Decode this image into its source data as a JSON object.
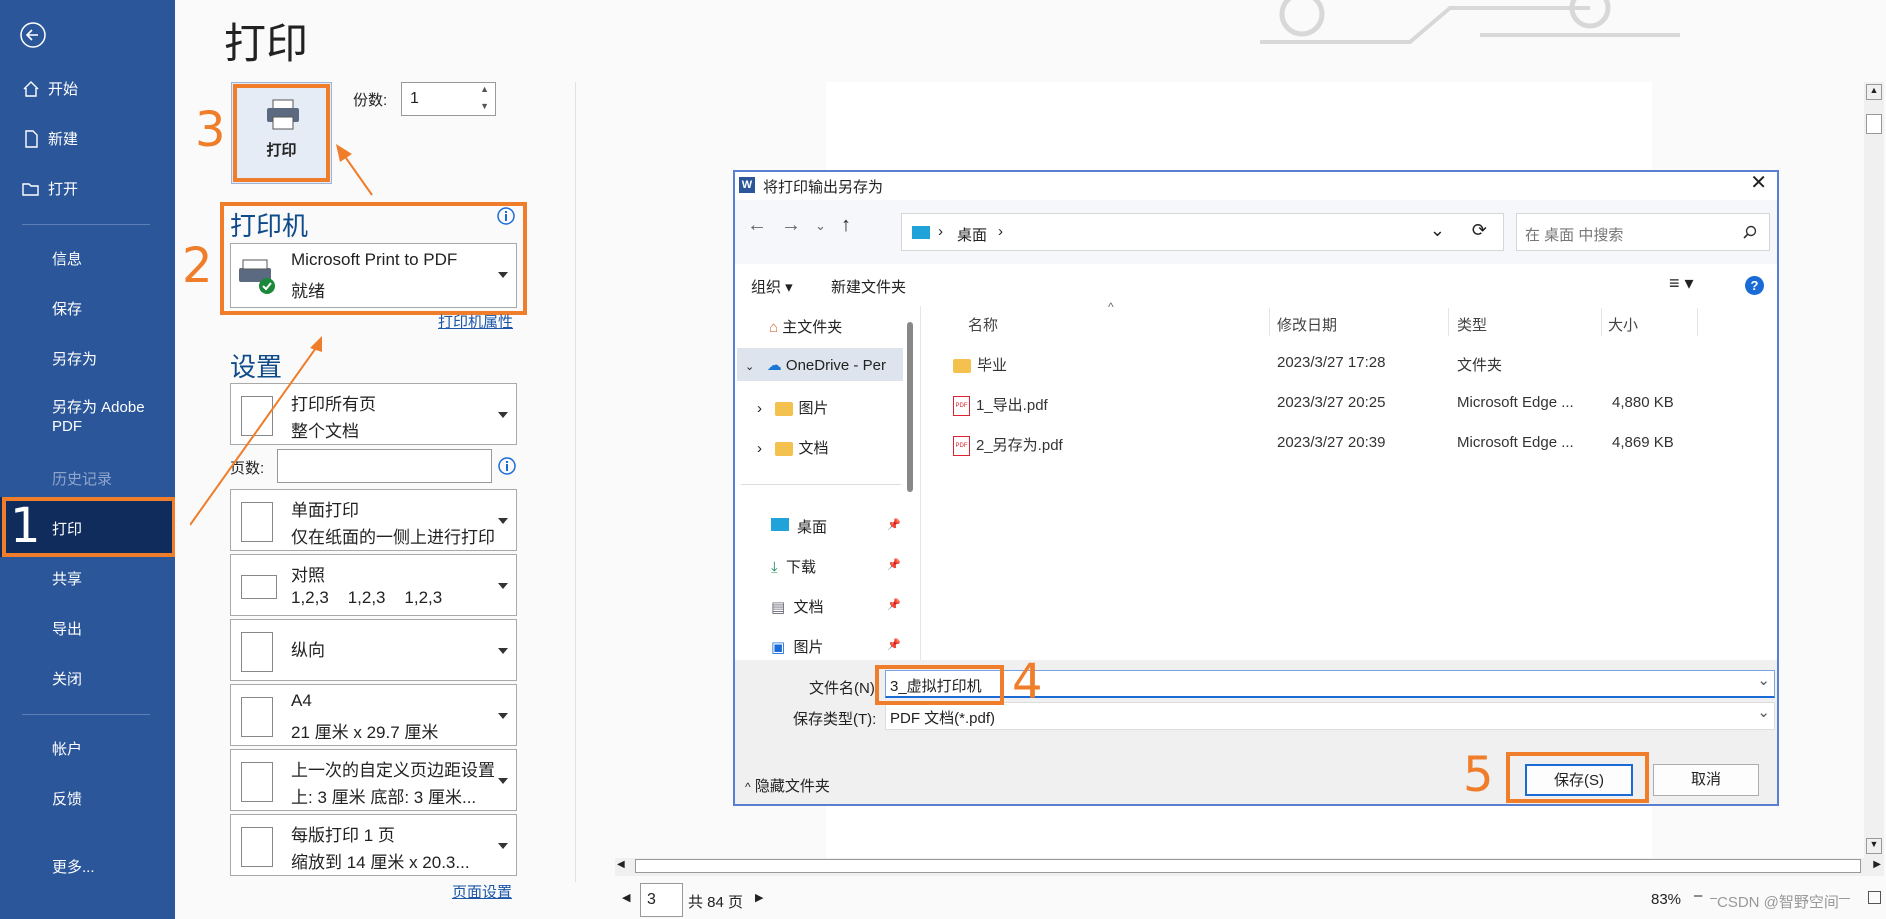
{
  "sidebar": {
    "back_icon": "back-arrow-icon",
    "items": [
      {
        "label": "开始",
        "icon": "home-icon"
      },
      {
        "label": "新建",
        "icon": "new-doc-icon"
      },
      {
        "label": "打开",
        "icon": "folder-open-icon"
      },
      {
        "label": "信息"
      },
      {
        "label": "保存"
      },
      {
        "label": "另存为"
      },
      {
        "label": "另存为 Adobe PDF"
      },
      {
        "label": "历史记录"
      },
      {
        "label": "打印"
      },
      {
        "label": "共享"
      },
      {
        "label": "导出"
      },
      {
        "label": "关闭"
      },
      {
        "label": "帐户"
      },
      {
        "label": "反馈"
      },
      {
        "label": "更多..."
      }
    ]
  },
  "annotations": {
    "n1": "1",
    "n2": "2",
    "n3": "3",
    "n4": "4",
    "n5": "5",
    "color": "#ef7d2a"
  },
  "print": {
    "title": "打印",
    "print_button": "打印",
    "copies_label": "份数:",
    "copies_value": "1",
    "printer_title": "打印机",
    "printer_name": "Microsoft Print to PDF",
    "printer_status": "就绪",
    "printer_props": "打印机属性",
    "settings_title": "设置",
    "opt_pages_1": "打印所有页",
    "opt_pages_2": "整个文档",
    "pages_label": "页数:",
    "opt_sides_1": "单面打印",
    "opt_sides_2": "仅在纸面的一侧上进行打印",
    "opt_collate_1": "对照",
    "opt_collate_2": "1,2,3    1,2,3    1,2,3",
    "opt_orient_1": "纵向",
    "opt_paper_1": "A4",
    "opt_paper_2": "21 厘米 x 29.7 厘米",
    "opt_margin_1": "上一次的自定义页边距设置",
    "opt_margin_2": "上: 3 厘米 底部: 3 厘米...",
    "opt_persheet_1": "每版打印 1 页",
    "opt_persheet_2": "缩放到 14 厘米 x 20.3...",
    "page_setup": "页面设置"
  },
  "preview_bar": {
    "page_value": "3",
    "page_total": "共 84 页",
    "zoom": "83%",
    "watermark": "CSDN @智野空间"
  },
  "dialog": {
    "title": "将打印输出另存为",
    "path": [
      "桌面"
    ],
    "search_placeholder": "在 桌面 中搜索",
    "organize": "组织",
    "new_folder": "新建文件夹",
    "nav": [
      {
        "label": "主文件夹"
      },
      {
        "label": "OneDrive - Per"
      },
      {
        "label": "图片"
      },
      {
        "label": "文档"
      },
      {
        "label": "桌面"
      },
      {
        "label": "下载"
      },
      {
        "label": "文档"
      },
      {
        "label": "图片"
      }
    ],
    "columns": [
      "名称",
      "修改日期",
      "类型",
      "大小"
    ],
    "rows": [
      {
        "name": "毕业",
        "date": "2023/3/27 17:28",
        "type": "文件夹",
        "size": ""
      },
      {
        "name": "1_导出.pdf",
        "date": "2023/3/27 20:25",
        "type": "Microsoft Edge ...",
        "size": "4,880 KB"
      },
      {
        "name": "2_另存为.pdf",
        "date": "2023/3/27 20:39",
        "type": "Microsoft Edge ...",
        "size": "4,869 KB"
      }
    ],
    "filename_label": "文件名(N):",
    "filename_value": "3_虚拟打印机",
    "filetype_label": "保存类型(T):",
    "filetype_value": "PDF 文档(*.pdf)",
    "hide_folders": "隐藏文件夹",
    "save": "保存(S)",
    "cancel": "取消"
  }
}
